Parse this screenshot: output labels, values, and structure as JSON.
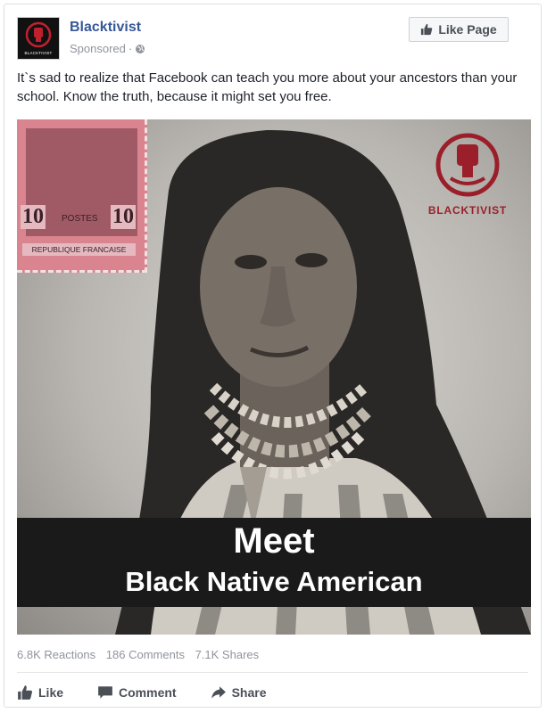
{
  "post": {
    "page_name": "Blacktivist",
    "sponsored_label": "Sponsored",
    "sponsored_separator": "·",
    "like_page_label": "Like Page",
    "text": "It`s sad to realize that Facebook can teach you more about your ancestors than your school. Know the truth, because it might set you free.",
    "avatar_caption": "BLACKTIVIST"
  },
  "image": {
    "stamp_value": "10",
    "stamp_postes": "POSTES",
    "stamp_country": "REPUBLIQUE FRANCAISE",
    "brand_name": "BLACKTIVIST",
    "headline": "Meet",
    "subheadline": "Black Native American"
  },
  "stats": {
    "reactions": "6.8K Reactions",
    "comments": "186 Comments",
    "shares": "7.1K Shares"
  },
  "actions": {
    "like": "Like",
    "comment": "Comment",
    "share": "Share"
  },
  "icons": {
    "globe": "globe-icon",
    "thumbs_up": "thumbs-up-icon",
    "comment": "comment-icon",
    "share": "share-arrow-icon",
    "fist": "raised-fist-icon"
  },
  "colors": {
    "page_name": "#365899",
    "meta_text": "#90949c",
    "brand_red": "#9b1f2a",
    "banner_bg": "#1a1a1a"
  }
}
